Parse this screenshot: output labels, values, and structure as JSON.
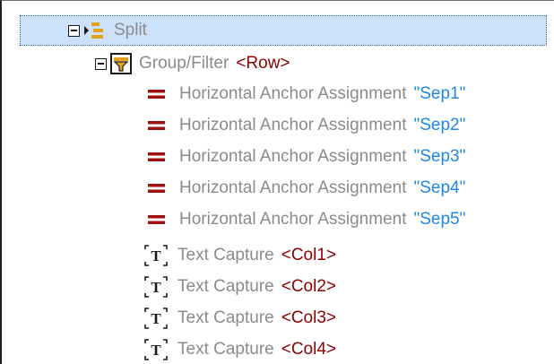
{
  "tree": {
    "split": {
      "label": "Split",
      "expanded": true,
      "icon": "split-icon"
    },
    "group": {
      "label": "Group/Filter",
      "value": "<Row>",
      "expanded": true,
      "icon": "group-filter-icon"
    },
    "anchors": [
      {
        "label": "Horizontal Anchor Assignment",
        "value": "\"Sep1\"",
        "icon": "equals-icon"
      },
      {
        "label": "Horizontal Anchor Assignment",
        "value": "\"Sep2\"",
        "icon": "equals-icon"
      },
      {
        "label": "Horizontal Anchor Assignment",
        "value": "\"Sep3\"",
        "icon": "equals-icon"
      },
      {
        "label": "Horizontal Anchor Assignment",
        "value": "\"Sep4\"",
        "icon": "equals-icon"
      },
      {
        "label": "Horizontal Anchor Assignment",
        "value": "\"Sep5\"",
        "icon": "equals-icon"
      }
    ],
    "captures": [
      {
        "label": "Text Capture",
        "value": "<Col1>",
        "icon": "text-capture-icon"
      },
      {
        "label": "Text Capture",
        "value": "<Col2>",
        "icon": "text-capture-icon"
      },
      {
        "label": "Text Capture",
        "value": "<Col3>",
        "icon": "text-capture-icon"
      },
      {
        "label": "Text Capture",
        "value": "<Col4>",
        "icon": "text-capture-icon"
      }
    ]
  },
  "colors": {
    "selection": "#cce2fa",
    "node_label": "#8b8b8b",
    "tag_value": "#8b0000",
    "string_value": "#1e88e5",
    "equals_icon": "#a01010"
  }
}
